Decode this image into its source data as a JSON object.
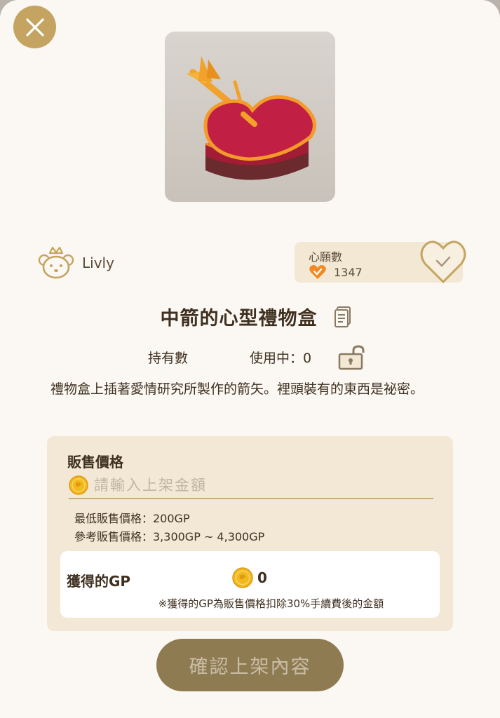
{
  "close_icon": "close-icon",
  "item_image": "heart-gift-box-with-arrow",
  "brand": {
    "name": "Livly",
    "icon": "livly-mascot-icon"
  },
  "wishlist": {
    "title": "心願數",
    "count": "1347",
    "icon": "heart-check-icon",
    "button_icon": "heart-outline-check-icon"
  },
  "item": {
    "title": "中箭的心型禮物盒",
    "copy_icon": "document-icon",
    "owned_label": "持有數",
    "in_use_label": "使用中：0",
    "lock_icon": "unlocked-padlock-icon",
    "description": "禮物盒上插著愛情研究所製作的箭矢。裡頭裝有的東西是祕密。"
  },
  "price": {
    "heading": "販售價格",
    "input_placeholder": "請輸入上架金額",
    "input_value": "",
    "min_price": "最低販售價格：200GP",
    "ref_price": "參考販售價格：3,300GP ~ 4,300GP"
  },
  "gp": {
    "label": "獲得的GP",
    "value": "0",
    "note": "※獲得的GP為販售價格扣除30%手續費後的金額"
  },
  "confirm_button": "確認上架內容",
  "colors": {
    "accent": "#c4a460",
    "button": "#8f7b52",
    "panel": "#f3e8d6",
    "heart": "#f08a24"
  }
}
